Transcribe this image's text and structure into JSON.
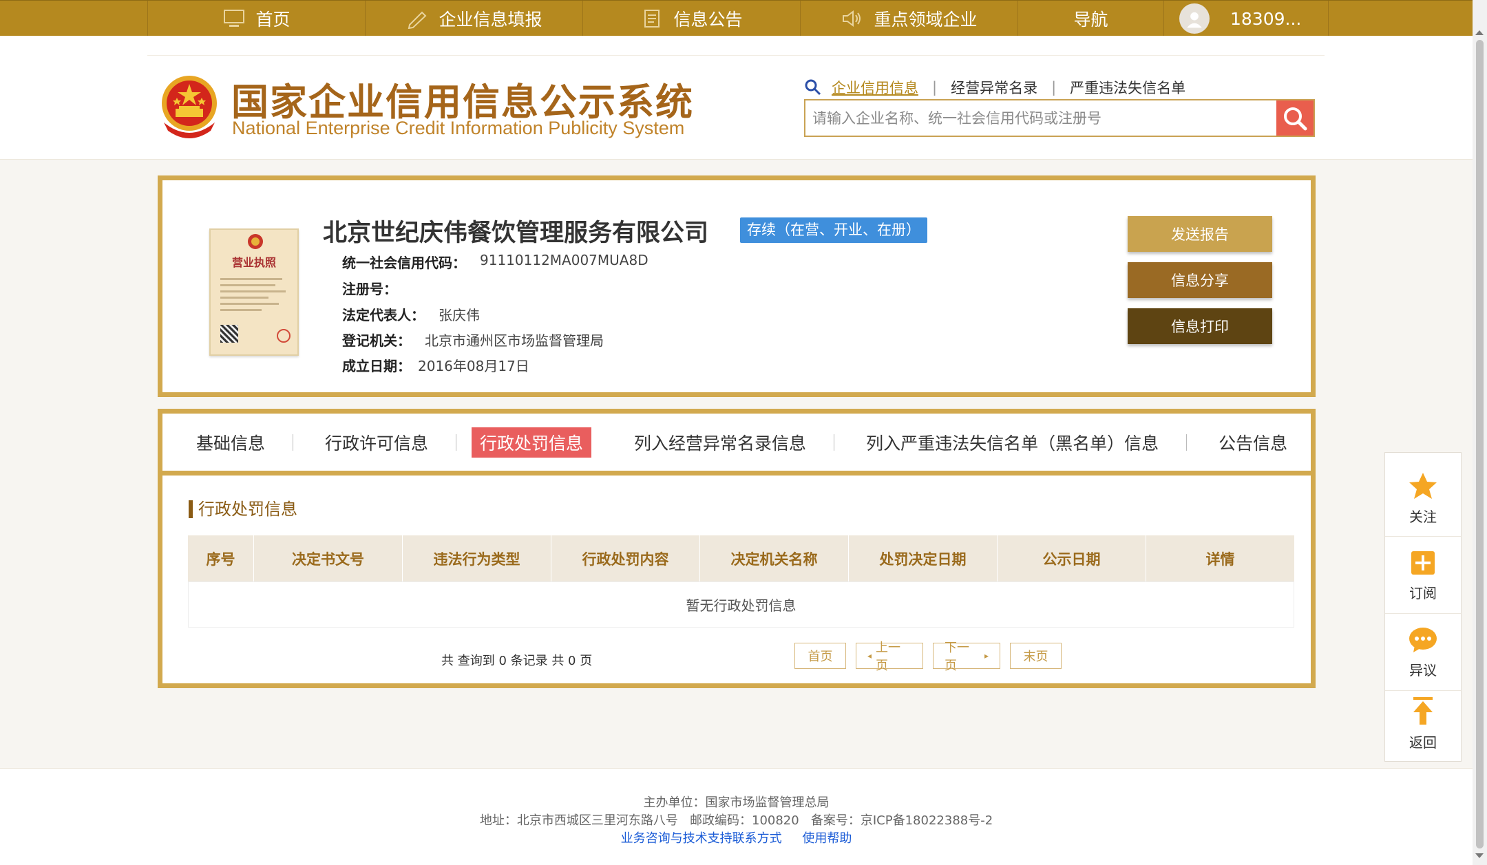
{
  "nav": {
    "items": [
      {
        "label": "首页",
        "icon": "monitor-icon"
      },
      {
        "label": "企业信息填报",
        "icon": "edit-icon"
      },
      {
        "label": "信息公告",
        "icon": "document-icon"
      },
      {
        "label": "重点领域企业",
        "icon": "speaker-icon"
      },
      {
        "label": "导航",
        "icon": ""
      }
    ],
    "user": "18309..."
  },
  "header": {
    "title_cn": "国家企业信用信息公示系统",
    "title_en": "National Enterprise Credit Information Publicity System",
    "search_links": [
      "企业信用信息",
      "经营异常名录",
      "严重违法失信名单"
    ],
    "search_placeholder": "请输入企业名称、统一社会信用代码或注册号"
  },
  "company": {
    "name": "北京世纪庆伟餐饮管理服务有限公司",
    "status": "存续（在营、开业、在册）",
    "license_title": "营业执照",
    "fields": [
      {
        "label": "统一社会信用代码：",
        "value": "91110112MA007MUA8D"
      },
      {
        "label": "注册号：",
        "value": ""
      },
      {
        "label": "法定代表人：",
        "value": "张庆伟"
      },
      {
        "label": "登记机关：",
        "value": "北京市通州区市场监督管理局"
      },
      {
        "label": "成立日期：",
        "value": "2016年08月17日"
      }
    ],
    "buttons": {
      "send": "发送报告",
      "share": "信息分享",
      "print": "信息打印"
    }
  },
  "tabs": [
    {
      "label": "基础信息",
      "active": false
    },
    {
      "label": "行政许可信息",
      "active": false
    },
    {
      "label": "行政处罚信息",
      "active": true
    },
    {
      "label": "列入经营异常名录信息",
      "active": false
    },
    {
      "label": "列入严重违法失信名单（黑名单）信息",
      "active": false
    },
    {
      "label": "公告信息",
      "active": false
    }
  ],
  "penalty": {
    "section_title": "行政处罚信息",
    "columns": [
      "序号",
      "决定书文号",
      "违法行为类型",
      "行政处罚内容",
      "决定机关名称",
      "处罚决定日期",
      "公示日期",
      "详情"
    ],
    "empty_text": "暂无行政处罚信息",
    "summary": "共 查询到 0 条记录 共 0 页",
    "pager": {
      "first": "首页",
      "prev": "上一页",
      "next": "下一页",
      "last": "末页"
    }
  },
  "footer": {
    "host": "主办单位：国家市场监督管理总局",
    "address": "地址：北京市西城区三里河东路八号   邮政编码：100820   备案号：京ICP备18022388号-2",
    "link_contact": "业务咨询与技术支持联系方式",
    "link_help": "使用帮助"
  },
  "sidebar": {
    "follow": "关注",
    "subscribe": "订阅",
    "objection": "异议",
    "back": "返回"
  },
  "colors": {
    "gold": "#b5891f",
    "border_gold": "#d2a94e",
    "red_active": "#e95e5e",
    "status_blue": "#3f8fdc",
    "btn_send": "#c9a34f",
    "btn_share": "#9a6a24",
    "btn_print": "#5e4412",
    "star_orange": "#f5a623"
  }
}
